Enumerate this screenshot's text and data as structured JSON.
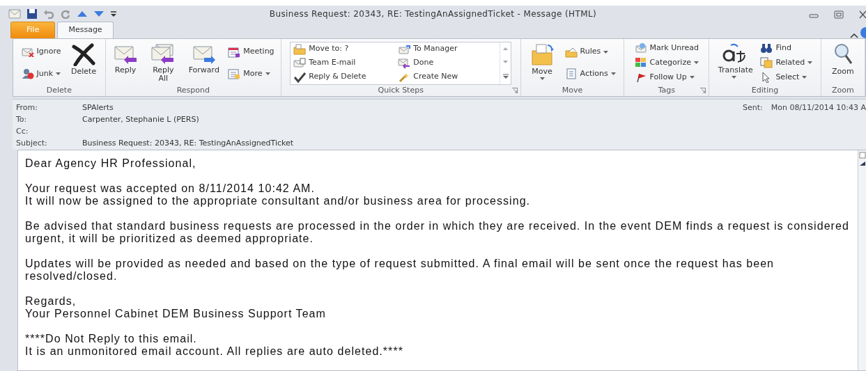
{
  "window": {
    "title": "Business Request: 20343, RE: TestingAnAssignedTicket  -  Message (HTML)"
  },
  "tabs": [
    {
      "label": "File",
      "selected": false,
      "kind": "file"
    },
    {
      "label": "Message",
      "selected": true,
      "kind": "tab"
    }
  ],
  "ribbon": [
    {
      "label": "Delete",
      "launcher": false,
      "columns": [
        {
          "kind": "stack",
          "items": [
            {
              "label": "Ignore",
              "dropdown": false
            },
            {
              "label": "Junk",
              "dropdown": true
            }
          ]
        },
        {
          "kind": "large",
          "label": "Delete",
          "dropdown": false
        }
      ]
    },
    {
      "label": "Respond",
      "launcher": false,
      "columns": [
        {
          "kind": "large",
          "label": "Reply",
          "dropdown": false
        },
        {
          "kind": "large",
          "label": "Reply All",
          "dropdown": false
        },
        {
          "kind": "large",
          "label": "Forward",
          "dropdown": false
        },
        {
          "kind": "stack",
          "items": [
            {
              "label": "Meeting",
              "dropdown": false
            },
            {
              "label": "More",
              "dropdown": true
            }
          ]
        }
      ]
    },
    {
      "label": "Quick Steps",
      "launcher": true,
      "columns": [
        {
          "kind": "gallery",
          "items": [
            {
              "label": "Move to: ?"
            },
            {
              "label": "To Manager"
            },
            {
              "label": "Team E-mail"
            },
            {
              "label": "Done"
            },
            {
              "label": "Reply & Delete"
            },
            {
              "label": "Create New"
            }
          ]
        }
      ]
    },
    {
      "label": "Move",
      "launcher": false,
      "columns": [
        {
          "kind": "large",
          "label": "Move",
          "dropdown": true
        },
        {
          "kind": "stack",
          "items": [
            {
              "label": "Rules",
              "dropdown": true
            },
            {
              "label": "Actions",
              "dropdown": true
            }
          ]
        }
      ]
    },
    {
      "label": "Tags",
      "launcher": true,
      "columns": [
        {
          "kind": "stack",
          "items": [
            {
              "label": "Mark Unread",
              "dropdown": false
            },
            {
              "label": "Categorize",
              "dropdown": true
            },
            {
              "label": "Follow Up",
              "dropdown": true
            }
          ]
        }
      ]
    },
    {
      "label": "Editing",
      "launcher": false,
      "columns": [
        {
          "kind": "large",
          "label": "Translate",
          "dropdown": true
        },
        {
          "kind": "stack",
          "items": [
            {
              "label": "Find",
              "dropdown": false
            },
            {
              "label": "Related",
              "dropdown": true
            },
            {
              "label": "Select",
              "dropdown": true
            }
          ]
        }
      ]
    },
    {
      "label": "Zoom",
      "launcher": false,
      "columns": [
        {
          "kind": "large",
          "label": "Zoom",
          "dropdown": false
        }
      ]
    }
  ],
  "header": {
    "fields": [
      {
        "label": "From:",
        "value": "SPAlerts"
      },
      {
        "label": "To:",
        "value": "Carpenter, Stephanie L   (PERS)"
      },
      {
        "label": "Cc:"
      },
      {
        "label": "Subject:",
        "value": "Business Request: 20343, RE: TestingAnAssignedTicket"
      }
    ],
    "sent": {
      "label": "Sent:",
      "value": "Mon 08/11/2014 10:43 A"
    }
  },
  "body": {
    "paragraphs": [
      [
        "Dear Agency HR Professional,"
      ],
      [
        "Your request was accepted on 8/11/2014 10:42 AM.",
        "It will now be assigned to the appropriate consultant and/or business area for processing."
      ],
      [
        "Be advised that standard business requests are processed in the order in which they are received. In the event DEM finds a request is considered urgent, it will be prioritized as deemed appropriate."
      ],
      [
        "Updates will be provided as needed and based on the type of request submitted. A final email will be sent once the request has been resolved/closed."
      ],
      [
        "Regards,",
        "Your Personnel Cabinet DEM Business Support Team"
      ],
      [
        "****Do Not Reply to this email.",
        "It is an unmonitored email account. All replies are auto deleted.****"
      ]
    ]
  }
}
